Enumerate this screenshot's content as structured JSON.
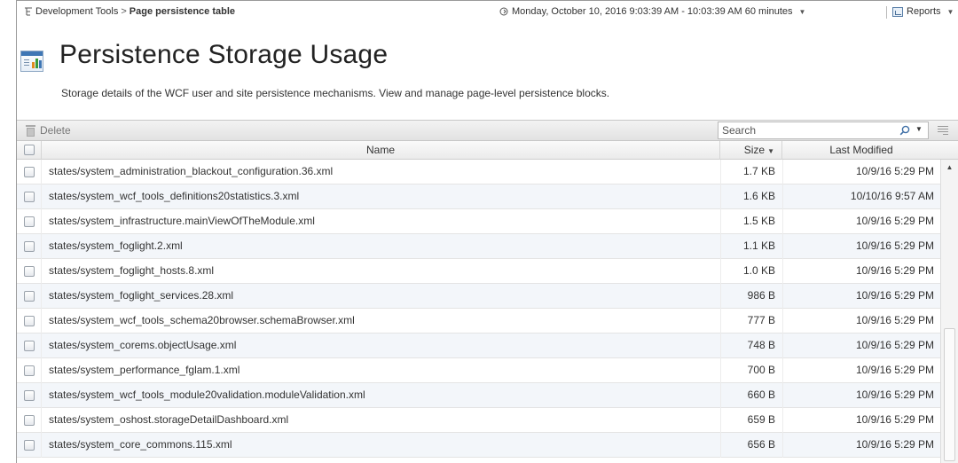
{
  "breadcrumb": {
    "parent": "Development Tools",
    "separator": ">",
    "current": "Page persistence table"
  },
  "time_range": {
    "text": "Monday, October 10, 2016 9:03:39 AM - 10:03:39 AM 60 minutes"
  },
  "reports": {
    "label": "Reports"
  },
  "page": {
    "title": "Persistence Storage Usage",
    "description": "Storage details of the WCF user and site persistence mechanisms. View and manage page-level persistence blocks."
  },
  "toolbar": {
    "delete_label": "Delete",
    "search_placeholder": "Search"
  },
  "table": {
    "columns": {
      "name": "Name",
      "size": "Size",
      "modified": "Last Modified"
    },
    "rows": [
      {
        "name": "states/system_administration_blackout_configuration.36.xml",
        "size": "1.7 KB",
        "modified": "10/9/16 5:29 PM"
      },
      {
        "name": "states/system_wcf_tools_definitions20statistics.3.xml",
        "size": "1.6 KB",
        "modified": "10/10/16 9:57 AM"
      },
      {
        "name": "states/system_infrastructure.mainViewOfTheModule.xml",
        "size": "1.5 KB",
        "modified": "10/9/16 5:29 PM"
      },
      {
        "name": "states/system_foglight.2.xml",
        "size": "1.1 KB",
        "modified": "10/9/16 5:29 PM"
      },
      {
        "name": "states/system_foglight_hosts.8.xml",
        "size": "1.0 KB",
        "modified": "10/9/16 5:29 PM"
      },
      {
        "name": "states/system_foglight_services.28.xml",
        "size": "986 B",
        "modified": "10/9/16 5:29 PM"
      },
      {
        "name": "states/system_wcf_tools_schema20browser.schemaBrowser.xml",
        "size": "777 B",
        "modified": "10/9/16 5:29 PM"
      },
      {
        "name": "states/system_corems.objectUsage.xml",
        "size": "748 B",
        "modified": "10/9/16 5:29 PM"
      },
      {
        "name": "states/system_performance_fglam.1.xml",
        "size": "700 B",
        "modified": "10/9/16 5:29 PM"
      },
      {
        "name": "states/system_wcf_tools_module20validation.moduleValidation.xml",
        "size": "660 B",
        "modified": "10/9/16 5:29 PM"
      },
      {
        "name": "states/system_oshost.storageDetailDashboard.xml",
        "size": "659 B",
        "modified": "10/9/16 5:29 PM"
      },
      {
        "name": "states/system_core_commons.115.xml",
        "size": "656 B",
        "modified": "10/9/16 5:29 PM"
      }
    ]
  },
  "icons": {
    "breadcrumb": "tree-icon",
    "time": "time-range-icon",
    "reports": "reports-icon",
    "title": "dashboard-icon",
    "delete": "trash-icon",
    "search": "search-icon",
    "columns": "column-chooser-icon"
  },
  "colors": {
    "accent": "#3f77b5",
    "row_alt": "#f3f6fa"
  }
}
